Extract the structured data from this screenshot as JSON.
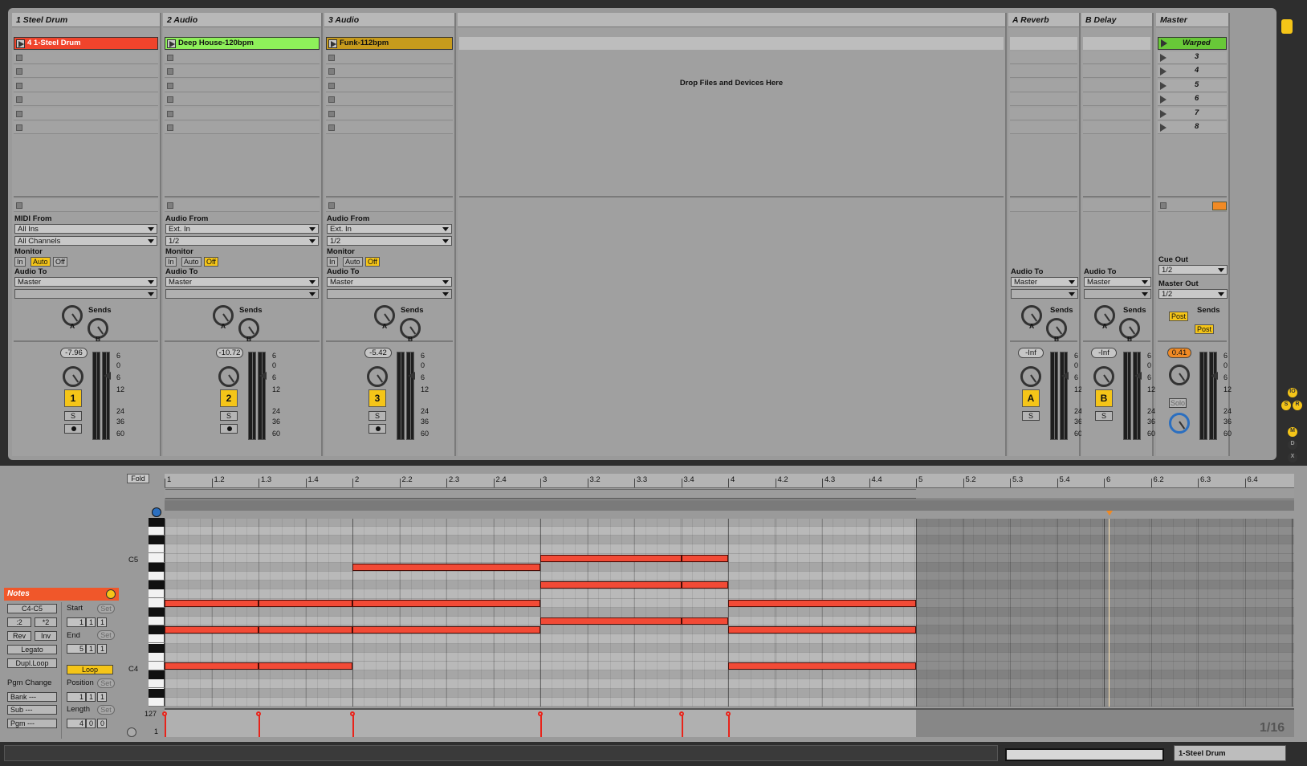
{
  "tracks": [
    {
      "name": "1 Steel Drum",
      "clip": "4 1-Steel Drum",
      "clip_color": "#f0442c",
      "io_label": "MIDI From",
      "in_src": "All Ins",
      "in_ch": "All Channels",
      "monitor": [
        "In",
        "Auto",
        "Off"
      ],
      "audio_to": "Master",
      "vol": "-7.96",
      "num": "1"
    },
    {
      "name": "2 Audio",
      "clip": "Deep House-120bpm",
      "clip_color": "#8ef05a",
      "io_label": "Audio From",
      "in_src": "Ext. In",
      "in_ch": "1/2",
      "monitor": [
        "In",
        "Auto",
        "Off"
      ],
      "audio_to": "Master",
      "vol": "-10.72",
      "num": "2"
    },
    {
      "name": "3 Audio",
      "clip": "Funk-112bpm",
      "clip_color": "#c79b1c",
      "io_label": "Audio From",
      "in_src": "Ext. In",
      "in_ch": "1/2",
      "monitor": [
        "In",
        "Auto",
        "Off"
      ],
      "audio_to": "Master",
      "vol": "-5.42",
      "num": "3"
    }
  ],
  "drop_hint": "Drop Files and Devices Here",
  "returns": [
    {
      "name": "A Reverb",
      "audio_to": "Master",
      "vol": "-Inf",
      "letter": "A"
    },
    {
      "name": "B Delay",
      "audio_to": "Master",
      "vol": "-Inf",
      "letter": "B"
    }
  ],
  "master": {
    "name": "Master",
    "scene1": "Warped",
    "scenes": [
      "3",
      "4",
      "5",
      "6",
      "7",
      "8"
    ],
    "cue_out_label": "Cue Out",
    "cue_out": "1/2",
    "master_out_label": "Master Out",
    "master_out": "1/2",
    "post": "Post",
    "vol": "0.41",
    "solo": "Solo"
  },
  "labels": {
    "monitor": "Monitor",
    "audio_to": "Audio To",
    "sends": "Sends",
    "knob_a": "A",
    "knob_b": "B",
    "solo_btn": "S"
  },
  "meter_scale": [
    "6",
    "0",
    "6",
    "12",
    "24",
    "36",
    "60"
  ],
  "detail": {
    "fold": "Fold",
    "notes_title": "Notes",
    "range": "C4-C5",
    "div2": ":2",
    "mul2": "*2",
    "rev": "Rev",
    "inv": "Inv",
    "legato": "Legato",
    "dupl": "Dupl.Loop",
    "start": "Start",
    "end": "End",
    "set": "Set",
    "loop": "Loop",
    "position": "Position",
    "length": "Length",
    "start_vals": [
      "1",
      "1",
      "1"
    ],
    "end_vals": [
      "5",
      "1",
      "1"
    ],
    "pos_vals": [
      "1",
      "1",
      "1"
    ],
    "len_vals": [
      "4",
      "0",
      "0"
    ],
    "pgm_change": "Pgm Change",
    "bank": "Bank ---",
    "sub": "Sub ---",
    "pgm": "Pgm ---",
    "c5": "C5",
    "c4": "C4",
    "vel_max": "127",
    "vel_min": "1",
    "grid": "1/16",
    "ruler": [
      "1",
      "1.2",
      "1.3",
      "1.4",
      "2",
      "2.2",
      "2.3",
      "2.4",
      "3",
      "3.2",
      "3.3",
      "3.4",
      "4",
      "4.2",
      "4.3",
      "4.4",
      "5",
      "5.2",
      "5.3",
      "5.4",
      "6",
      "6.2",
      "6.3",
      "6.4"
    ]
  },
  "status": {
    "track": "1-Steel Drum"
  },
  "side_io": [
    "IO",
    "S",
    "R",
    "M",
    "D",
    "X"
  ],
  "notes": [
    {
      "pitch": 11,
      "start": 0.0,
      "len": 0.5
    },
    {
      "pitch": 11,
      "start": 0.5,
      "len": 0.5
    },
    {
      "pitch": 11,
      "start": 1.0,
      "len": 1.0
    },
    {
      "pitch": 11,
      "start": 3.0,
      "len": 1.0
    },
    {
      "pitch": 8,
      "start": 0.0,
      "len": 0.5
    },
    {
      "pitch": 8,
      "start": 0.5,
      "len": 0.5
    },
    {
      "pitch": 8,
      "start": 1.0,
      "len": 1.0
    },
    {
      "pitch": 8,
      "start": 3.0,
      "len": 1.0
    },
    {
      "pitch": 4,
      "start": 0.0,
      "len": 0.5
    },
    {
      "pitch": 4,
      "start": 0.5,
      "len": 0.5
    },
    {
      "pitch": 4,
      "start": 3.0,
      "len": 1.0
    },
    {
      "pitch": 15,
      "start": 1.0,
      "len": 1.0
    },
    {
      "pitch": 16,
      "start": 2.0,
      "len": 0.75
    },
    {
      "pitch": 16,
      "start": 2.75,
      "len": 0.25
    },
    {
      "pitch": 13,
      "start": 2.0,
      "len": 0.75
    },
    {
      "pitch": 13,
      "start": 2.75,
      "len": 0.25
    },
    {
      "pitch": 9,
      "start": 2.0,
      "len": 0.75
    },
    {
      "pitch": 9,
      "start": 2.75,
      "len": 0.25
    }
  ],
  "velocities": [
    0.0,
    0.5,
    1.0,
    2.0,
    2.75,
    3.0
  ]
}
